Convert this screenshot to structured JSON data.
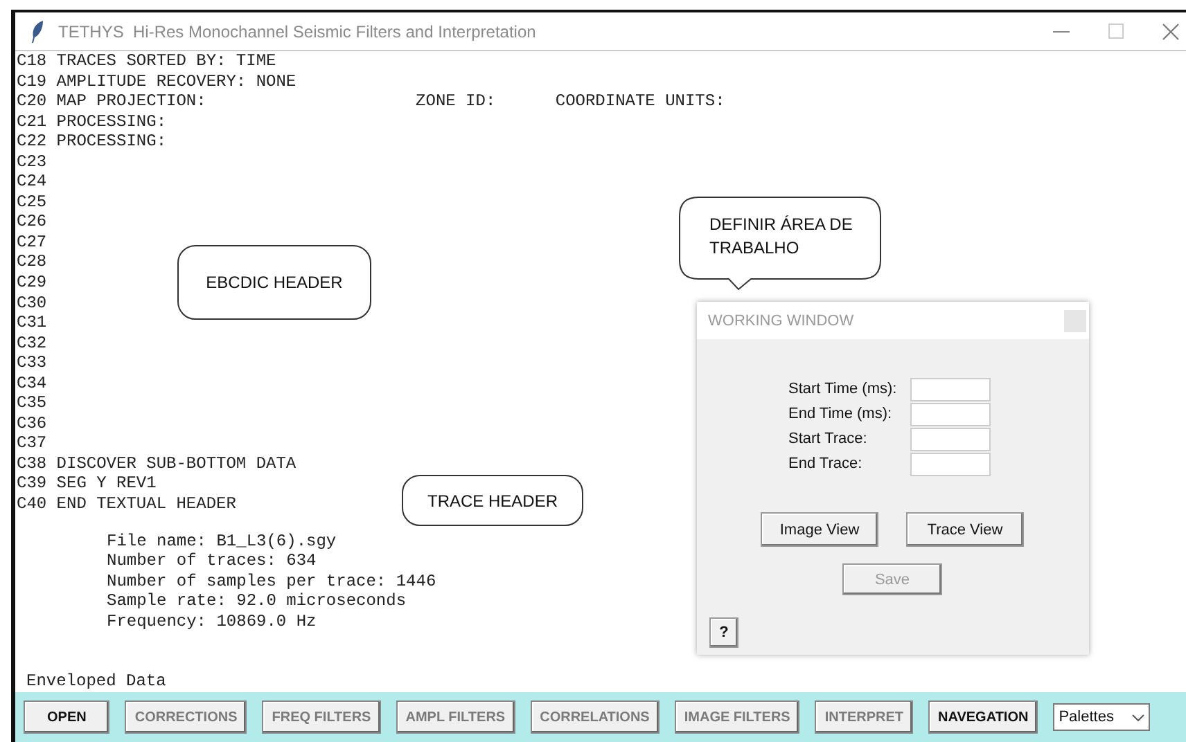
{
  "window": {
    "title": "TETHYS  Hi-Res Monochannel Seismic Filters and Interpretation"
  },
  "header_lines": [
    "C18 TRACES SORTED BY: TIME",
    "C19 AMPLITUDE RECOVERY: NONE",
    "C20 MAP PROJECTION:                     ZONE ID:      COORDINATE UNITS:",
    "C21 PROCESSING:",
    "C22 PROCESSING:",
    "C23",
    "C24",
    "C25",
    "C26",
    "C27",
    "C28",
    "C29",
    "C30",
    "C31",
    "C32",
    "C33",
    "C34",
    "C35",
    "C36",
    "C37",
    "C38 DISCOVER SUB-BOTTOM DATA",
    "C39 SEG Y REV1",
    "C40 END TEXTUAL HEADER"
  ],
  "file_info": [
    "File name: B1_L3(6).sgy",
    "Number of traces: 634",
    "Number of samples per trace: 1446",
    "Sample rate: 92.0 microseconds",
    "Frequency: 10869.0 Hz"
  ],
  "status": "Enveloped Data",
  "callouts": [
    {
      "kind": "box",
      "text": "EBCDIC HEADER"
    },
    {
      "kind": "box",
      "text": "TRACE HEADER"
    },
    {
      "kind": "speech",
      "text": "DEFINIR ÁREA DE TRABALHO"
    }
  ],
  "working_window": {
    "title": "WORKING WINDOW",
    "fields": [
      {
        "label": "Start Time (ms):"
      },
      {
        "label": "End Time (ms):"
      },
      {
        "label": "Start Trace:"
      },
      {
        "label": "End Trace:"
      }
    ],
    "view_buttons": [
      {
        "label": "Image View",
        "disabled": false
      },
      {
        "label": "Trace View",
        "disabled": false
      }
    ],
    "save_button": {
      "label": "Save",
      "disabled": true
    },
    "help_button": "?"
  },
  "toolbar": {
    "buttons": [
      {
        "label": "OPEN",
        "disabled": false
      },
      {
        "label": "CORRECTIONS",
        "disabled": true
      },
      {
        "label": "FREQ FILTERS",
        "disabled": true
      },
      {
        "label": "AMPL FILTERS",
        "disabled": true
      },
      {
        "label": "CORRELATIONS",
        "disabled": true
      },
      {
        "label": "IMAGE FILTERS",
        "disabled": true
      },
      {
        "label": "INTERPRET",
        "disabled": true
      },
      {
        "label": "NAVEGATION",
        "disabled": false
      }
    ],
    "dropdown": {
      "value": "Palettes"
    }
  }
}
